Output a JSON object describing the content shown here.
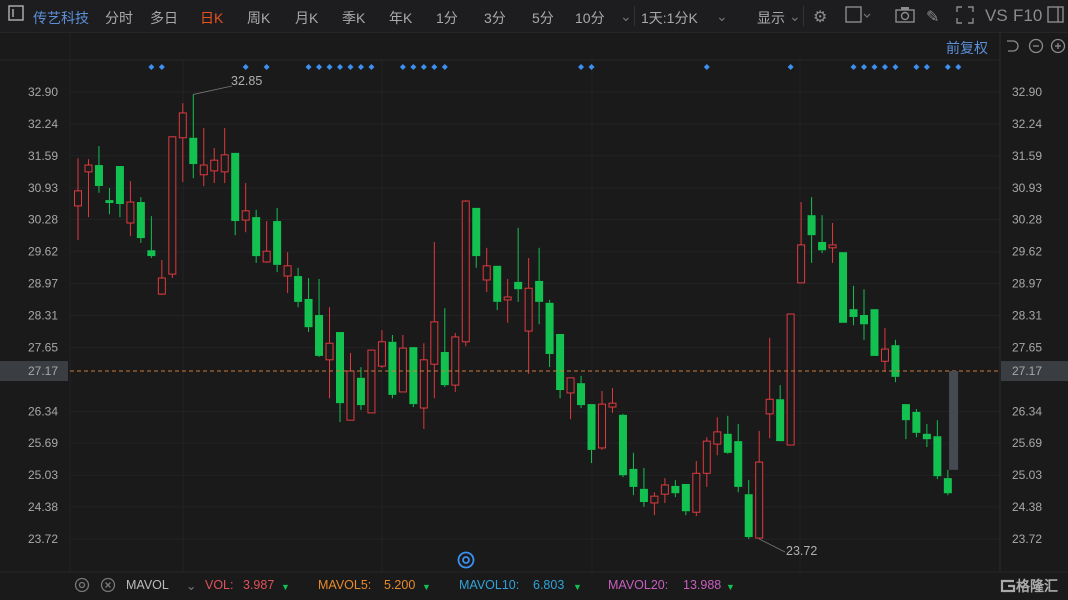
{
  "toolbar": {
    "stock_name": "传艺科技",
    "periods": [
      "分时",
      "多日",
      "日K",
      "周K",
      "月K",
      "季K",
      "年K",
      "1分",
      "3分",
      "5分",
      "10分"
    ],
    "active_period": "日K",
    "range_select": "1天:1分K",
    "display_label": "显示",
    "vs_label": "VS",
    "f10_label": "F10",
    "icons": [
      "sidebar-toggle-icon",
      "chevron-down-icon",
      "settings-icon",
      "square-icon",
      "camera-icon",
      "pencil-icon",
      "fullscreen-icon",
      "panel-icon"
    ]
  },
  "subbar": {
    "adjust_label": "前复权",
    "icons": [
      "undo-icon",
      "zoom-out-icon",
      "zoom-in-icon"
    ]
  },
  "colors": {
    "up": "#e0393e",
    "down": "#13c150",
    "accent": "#e8531f",
    "current_line": "#c87a3c",
    "marker": "#3d8ff0"
  },
  "chart_data": {
    "type": "candlestick",
    "y_ticks": [
      "32.90",
      "32.24",
      "31.59",
      "30.93",
      "30.28",
      "29.62",
      "28.97",
      "28.31",
      "27.65",
      "27.17",
      "26.34",
      "25.69",
      "25.03",
      "24.38",
      "23.72"
    ],
    "ylim": [
      23.72,
      32.9
    ],
    "current_price": "27.17",
    "high_label": "32.85",
    "low_label": "23.72",
    "high_index": 11,
    "low_index": 65,
    "ohlc": [
      [
        30.56,
        31.54,
        29.86,
        30.87
      ],
      [
        31.26,
        31.52,
        30.33,
        31.4
      ],
      [
        31.4,
        31.79,
        30.83,
        30.97
      ],
      [
        30.68,
        30.93,
        30.39,
        30.62
      ],
      [
        31.38,
        31.38,
        30.33,
        30.6
      ],
      [
        30.21,
        31.07,
        29.94,
        30.64
      ],
      [
        30.64,
        30.74,
        29.8,
        29.9
      ],
      [
        29.65,
        30.35,
        29.49,
        29.53
      ],
      [
        28.75,
        29.45,
        28.73,
        29.08
      ],
      [
        29.16,
        31.98,
        29.08,
        31.98
      ],
      [
        31.96,
        32.67,
        31.05,
        32.47
      ],
      [
        31.96,
        32.85,
        31.13,
        31.42
      ],
      [
        31.2,
        32.16,
        30.97,
        31.4
      ],
      [
        31.28,
        31.75,
        31.03,
        31.5
      ],
      [
        31.26,
        32.16,
        31.03,
        31.61
      ],
      [
        31.65,
        31.65,
        29.96,
        30.25
      ],
      [
        30.27,
        31.03,
        30.02,
        30.46
      ],
      [
        30.33,
        30.48,
        29.39,
        29.53
      ],
      [
        29.41,
        30.25,
        29.39,
        29.63
      ],
      [
        30.25,
        30.52,
        29.2,
        29.35
      ],
      [
        29.12,
        29.61,
        28.77,
        29.33
      ],
      [
        29.12,
        29.29,
        28.48,
        28.59
      ],
      [
        28.65,
        29.08,
        27.97,
        28.07
      ],
      [
        28.32,
        29.06,
        27.46,
        27.48
      ],
      [
        27.4,
        28.48,
        26.61,
        27.74
      ],
      [
        27.97,
        27.97,
        26.12,
        26.51
      ],
      [
        26.16,
        27.54,
        26.16,
        27.17
      ],
      [
        27.03,
        27.25,
        26.37,
        26.47
      ],
      [
        26.31,
        27.6,
        26.31,
        27.6
      ],
      [
        27.27,
        28.01,
        27.23,
        27.77
      ],
      [
        27.77,
        27.91,
        26.61,
        26.68
      ],
      [
        26.74,
        27.91,
        26.74,
        27.64
      ],
      [
        27.66,
        27.66,
        26.43,
        26.49
      ],
      [
        26.41,
        27.74,
        25.98,
        27.4
      ],
      [
        27.31,
        29.82,
        26.61,
        28.18
      ],
      [
        27.56,
        28.46,
        26.84,
        26.88
      ],
      [
        26.88,
        27.95,
        26.74,
        27.87
      ],
      [
        27.77,
        30.68,
        27.68,
        30.66
      ],
      [
        30.52,
        30.52,
        29.29,
        29.53
      ],
      [
        29.04,
        29.7,
        28.79,
        29.33
      ],
      [
        29.33,
        29.33,
        28.42,
        28.59
      ],
      [
        28.63,
        29.06,
        28.16,
        28.69
      ],
      [
        29.0,
        30.11,
        28.59,
        28.85
      ],
      [
        27.99,
        29.49,
        27.11,
        28.87
      ],
      [
        29.02,
        29.7,
        28.13,
        28.59
      ],
      [
        28.57,
        28.63,
        27.25,
        27.52
      ],
      [
        27.93,
        27.93,
        26.61,
        26.78
      ],
      [
        26.72,
        27.03,
        26.18,
        27.03
      ],
      [
        26.92,
        27.07,
        26.41,
        26.47
      ],
      [
        26.49,
        26.49,
        25.28,
        25.55
      ],
      [
        25.59,
        26.76,
        25.55,
        26.49
      ],
      [
        26.43,
        26.82,
        26.31,
        26.51
      ],
      [
        26.27,
        26.29,
        24.99,
        25.03
      ],
      [
        25.16,
        25.49,
        24.62,
        24.79
      ],
      [
        24.75,
        25.18,
        24.38,
        24.48
      ],
      [
        24.46,
        24.68,
        24.21,
        24.6
      ],
      [
        24.64,
        24.97,
        24.46,
        24.83
      ],
      [
        24.81,
        24.93,
        24.58,
        24.66
      ],
      [
        24.85,
        24.85,
        24.21,
        24.29
      ],
      [
        24.27,
        25.32,
        24.19,
        25.07
      ],
      [
        25.07,
        25.81,
        24.79,
        25.73
      ],
      [
        25.67,
        26.22,
        25.44,
        25.92
      ],
      [
        25.88,
        26.25,
        25.47,
        25.49
      ],
      [
        25.73,
        26.08,
        24.68,
        24.79
      ],
      [
        24.64,
        24.93,
        23.72,
        23.76
      ],
      [
        23.74,
        25.94,
        23.72,
        25.3
      ],
      [
        26.29,
        27.85,
        25.79,
        26.59
      ],
      [
        26.59,
        26.88,
        25.73,
        25.73
      ],
      [
        25.65,
        28.34,
        25.65,
        28.34
      ],
      [
        28.98,
        30.64,
        28.98,
        29.76
      ],
      [
        30.37,
        30.74,
        29.39,
        29.96
      ],
      [
        29.82,
        30.37,
        29.59,
        29.65
      ],
      [
        29.7,
        30.21,
        29.39,
        29.76
      ],
      [
        29.61,
        29.61,
        28.16,
        28.16
      ],
      [
        28.44,
        28.92,
        28.11,
        28.28
      ],
      [
        28.32,
        28.85,
        27.81,
        28.13
      ],
      [
        28.44,
        28.44,
        27.48,
        27.48
      ],
      [
        27.37,
        28.05,
        27.15,
        27.62
      ],
      [
        27.7,
        27.81,
        26.94,
        27.05
      ],
      [
        26.49,
        26.49,
        25.77,
        26.16
      ],
      [
        26.33,
        26.39,
        25.81,
        25.9
      ],
      [
        25.88,
        26.08,
        25.61,
        25.77
      ],
      [
        25.83,
        26.16,
        24.95,
        25.01
      ],
      [
        24.97,
        25.14,
        24.62,
        24.66
      ]
    ],
    "pending_bar": [
      27.17,
      25.14
    ],
    "event_marker_indices": [
      7,
      8,
      16,
      18,
      22,
      23,
      24,
      25,
      26,
      27,
      28,
      31,
      32,
      33,
      34,
      35,
      48,
      49,
      60,
      68,
      74,
      75,
      76,
      77,
      78,
      80,
      81,
      83,
      84
    ]
  },
  "indicator_bar": {
    "name": "MAVOL",
    "items": [
      {
        "label": "VOL:",
        "value": "3.987",
        "color": "#e0525a"
      },
      {
        "label": "MAVOL5:",
        "value": "5.200",
        "color": "#e88a2a"
      },
      {
        "label": "MAVOL10:",
        "value": "6.803",
        "color": "#2ea3d8"
      },
      {
        "label": "MAVOL20:",
        "value": "13.988",
        "color": "#c85ec0"
      }
    ],
    "brand": "格隆汇"
  }
}
